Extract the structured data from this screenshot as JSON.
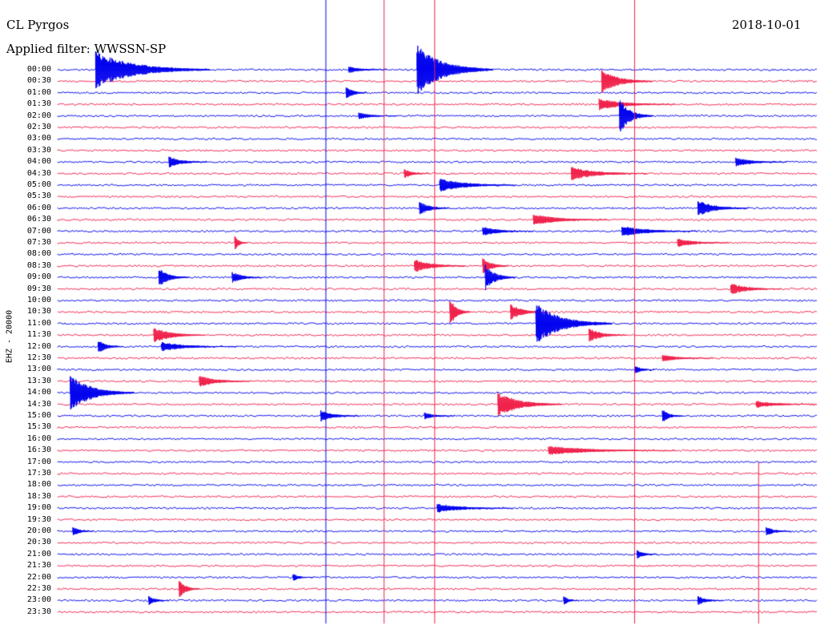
{
  "header": {
    "station": "CL Pyrgos",
    "filter": "Applied filter: WWSSN-SP",
    "date": "2018-10-01",
    "channel_label": "EHZ - 20000"
  },
  "colors": {
    "trace_a": "#0000ee",
    "trace_b": "#f0204a",
    "text": "#000000",
    "background": "#ffffff"
  },
  "chart_data": {
    "type": "helicorder",
    "title": "CL Pyrgos",
    "subtitle": "Applied filter: WWSSN-SP",
    "date": "2018-10-01",
    "ylabel": "EHZ - 20000",
    "row_minutes": 30,
    "row_labels": [
      "00:00",
      "00:30",
      "01:00",
      "01:30",
      "02:00",
      "02:30",
      "03:00",
      "03:30",
      "04:00",
      "04:30",
      "05:00",
      "05:30",
      "06:00",
      "06:30",
      "07:00",
      "07:30",
      "08:00",
      "08:30",
      "09:00",
      "09:30",
      "10:00",
      "10:30",
      "11:00",
      "11:30",
      "12:00",
      "12:30",
      "13:00",
      "13:30",
      "14:00",
      "14:30",
      "15:00",
      "15:30",
      "16:00",
      "16:30",
      "17:00",
      "17:30",
      "18:00",
      "18:30",
      "19:00",
      "19:30",
      "20:00",
      "20:30",
      "21:00",
      "21:30",
      "22:00",
      "22:30",
      "23:00",
      "23:30"
    ],
    "row_colors": [
      "a",
      "b",
      "a",
      "b",
      "a",
      "b",
      "a",
      "b",
      "a",
      "b",
      "a",
      "b",
      "a",
      "b",
      "a",
      "b",
      "a",
      "b",
      "a",
      "b",
      "a",
      "b",
      "a",
      "b",
      "a",
      "b",
      "a",
      "b",
      "a",
      "b",
      "a",
      "b",
      "a",
      "b",
      "a",
      "b",
      "a",
      "b",
      "a",
      "b",
      "a",
      "b",
      "a",
      "b",
      "a",
      "b",
      "a",
      "b"
    ],
    "events": [
      {
        "row": 0,
        "minute": 1.5,
        "amplitude": 1.6,
        "duration": 4.5
      },
      {
        "row": 0,
        "minute": 11.5,
        "amplitude": 0.3,
        "duration": 1.5
      },
      {
        "row": 0,
        "minute": 14.2,
        "amplitude": 2.2,
        "duration": 3
      },
      {
        "row": 1,
        "minute": 21.5,
        "amplitude": 1.0,
        "duration": 2
      },
      {
        "row": 2,
        "minute": 11.4,
        "amplitude": 0.6,
        "duration": 0.8
      },
      {
        "row": 3,
        "minute": 21.4,
        "amplitude": 0.5,
        "duration": 3
      },
      {
        "row": 4,
        "minute": 11.9,
        "amplitude": 0.3,
        "duration": 1.5
      },
      {
        "row": 4,
        "minute": 22.2,
        "amplitude": 1.5,
        "duration": 1.3
      },
      {
        "row": 8,
        "minute": 4.4,
        "amplitude": 0.5,
        "duration": 1.5
      },
      {
        "row": 8,
        "minute": 26.8,
        "amplitude": 0.4,
        "duration": 2
      },
      {
        "row": 9,
        "minute": 13.7,
        "amplitude": 0.4,
        "duration": 1
      },
      {
        "row": 9,
        "minute": 20.3,
        "amplitude": 0.6,
        "duration": 3
      },
      {
        "row": 10,
        "minute": 15.1,
        "amplitude": 0.6,
        "duration": 3
      },
      {
        "row": 12,
        "minute": 14.3,
        "amplitude": 0.6,
        "duration": 1.2
      },
      {
        "row": 12,
        "minute": 25.3,
        "amplitude": 0.7,
        "duration": 2
      },
      {
        "row": 13,
        "minute": 18.8,
        "amplitude": 0.5,
        "duration": 3
      },
      {
        "row": 14,
        "minute": 16.8,
        "amplitude": 0.4,
        "duration": 2
      },
      {
        "row": 14,
        "minute": 22.3,
        "amplitude": 0.5,
        "duration": 3
      },
      {
        "row": 15,
        "minute": 7.0,
        "amplitude": 0.6,
        "duration": 0.5
      },
      {
        "row": 15,
        "minute": 24.5,
        "amplitude": 0.4,
        "duration": 2
      },
      {
        "row": 17,
        "minute": 14.1,
        "amplitude": 0.6,
        "duration": 2
      },
      {
        "row": 17,
        "minute": 16.8,
        "amplitude": 0.8,
        "duration": 1
      },
      {
        "row": 18,
        "minute": 4.0,
        "amplitude": 0.8,
        "duration": 1.2
      },
      {
        "row": 18,
        "minute": 6.9,
        "amplitude": 0.5,
        "duration": 1.2
      },
      {
        "row": 18,
        "minute": 16.9,
        "amplitude": 1.1,
        "duration": 1.2
      },
      {
        "row": 19,
        "minute": 26.6,
        "amplitude": 0.5,
        "duration": 2
      },
      {
        "row": 21,
        "minute": 15.5,
        "amplitude": 1.2,
        "duration": 0.8
      },
      {
        "row": 21,
        "minute": 17.9,
        "amplitude": 0.7,
        "duration": 1.4
      },
      {
        "row": 22,
        "minute": 18.9,
        "amplitude": 1.8,
        "duration": 3
      },
      {
        "row": 23,
        "minute": 3.8,
        "amplitude": 0.7,
        "duration": 2
      },
      {
        "row": 23,
        "minute": 21.0,
        "amplitude": 0.6,
        "duration": 1.5
      },
      {
        "row": 24,
        "minute": 1.6,
        "amplitude": 0.6,
        "duration": 1
      },
      {
        "row": 24,
        "minute": 4.1,
        "amplitude": 0.4,
        "duration": 3
      },
      {
        "row": 25,
        "minute": 23.9,
        "amplitude": 0.3,
        "duration": 2
      },
      {
        "row": 26,
        "minute": 22.8,
        "amplitude": 0.4,
        "duration": 0.8
      },
      {
        "row": 27,
        "minute": 5.6,
        "amplitude": 0.5,
        "duration": 2
      },
      {
        "row": 28,
        "minute": 0.5,
        "amplitude": 1.6,
        "duration": 2.5
      },
      {
        "row": 29,
        "minute": 17.4,
        "amplitude": 1.1,
        "duration": 2.5
      },
      {
        "row": 29,
        "minute": 27.6,
        "amplitude": 0.3,
        "duration": 2.5
      },
      {
        "row": 30,
        "minute": 10.4,
        "amplitude": 0.5,
        "duration": 1.5
      },
      {
        "row": 30,
        "minute": 14.5,
        "amplitude": 0.3,
        "duration": 1.2
      },
      {
        "row": 30,
        "minute": 23.9,
        "amplitude": 0.6,
        "duration": 0.8
      },
      {
        "row": 33,
        "minute": 19.4,
        "amplitude": 0.4,
        "duration": 5
      },
      {
        "row": 38,
        "minute": 15.0,
        "amplitude": 0.4,
        "duration": 3
      },
      {
        "row": 40,
        "minute": 0.6,
        "amplitude": 0.4,
        "duration": 0.8
      },
      {
        "row": 40,
        "minute": 28.0,
        "amplitude": 0.4,
        "duration": 1
      },
      {
        "row": 42,
        "minute": 22.9,
        "amplitude": 0.4,
        "duration": 0.8
      },
      {
        "row": 44,
        "minute": 9.3,
        "amplitude": 0.3,
        "duration": 0.8
      },
      {
        "row": 45,
        "minute": 4.8,
        "amplitude": 0.8,
        "duration": 0.8
      },
      {
        "row": 46,
        "minute": 3.6,
        "amplitude": 0.4,
        "duration": 0.8
      },
      {
        "row": 46,
        "minute": 20.0,
        "amplitude": 0.4,
        "duration": 0.6
      },
      {
        "row": 46,
        "minute": 25.3,
        "amplitude": 0.4,
        "duration": 1
      }
    ],
    "spikes": [
      {
        "minute": 10.6,
        "row_start": 0,
        "row_end": 48,
        "color": "a"
      },
      {
        "minute": 12.9,
        "row_start": 0,
        "row_end": 48,
        "color": "b"
      },
      {
        "minute": 14.9,
        "row_start": 0,
        "row_end": 48,
        "color": "b"
      },
      {
        "minute": 22.8,
        "row_start": 0,
        "row_end": 48,
        "color": "b"
      },
      {
        "minute": 27.7,
        "row_start": 34,
        "row_end": 48,
        "color": "b"
      }
    ]
  }
}
